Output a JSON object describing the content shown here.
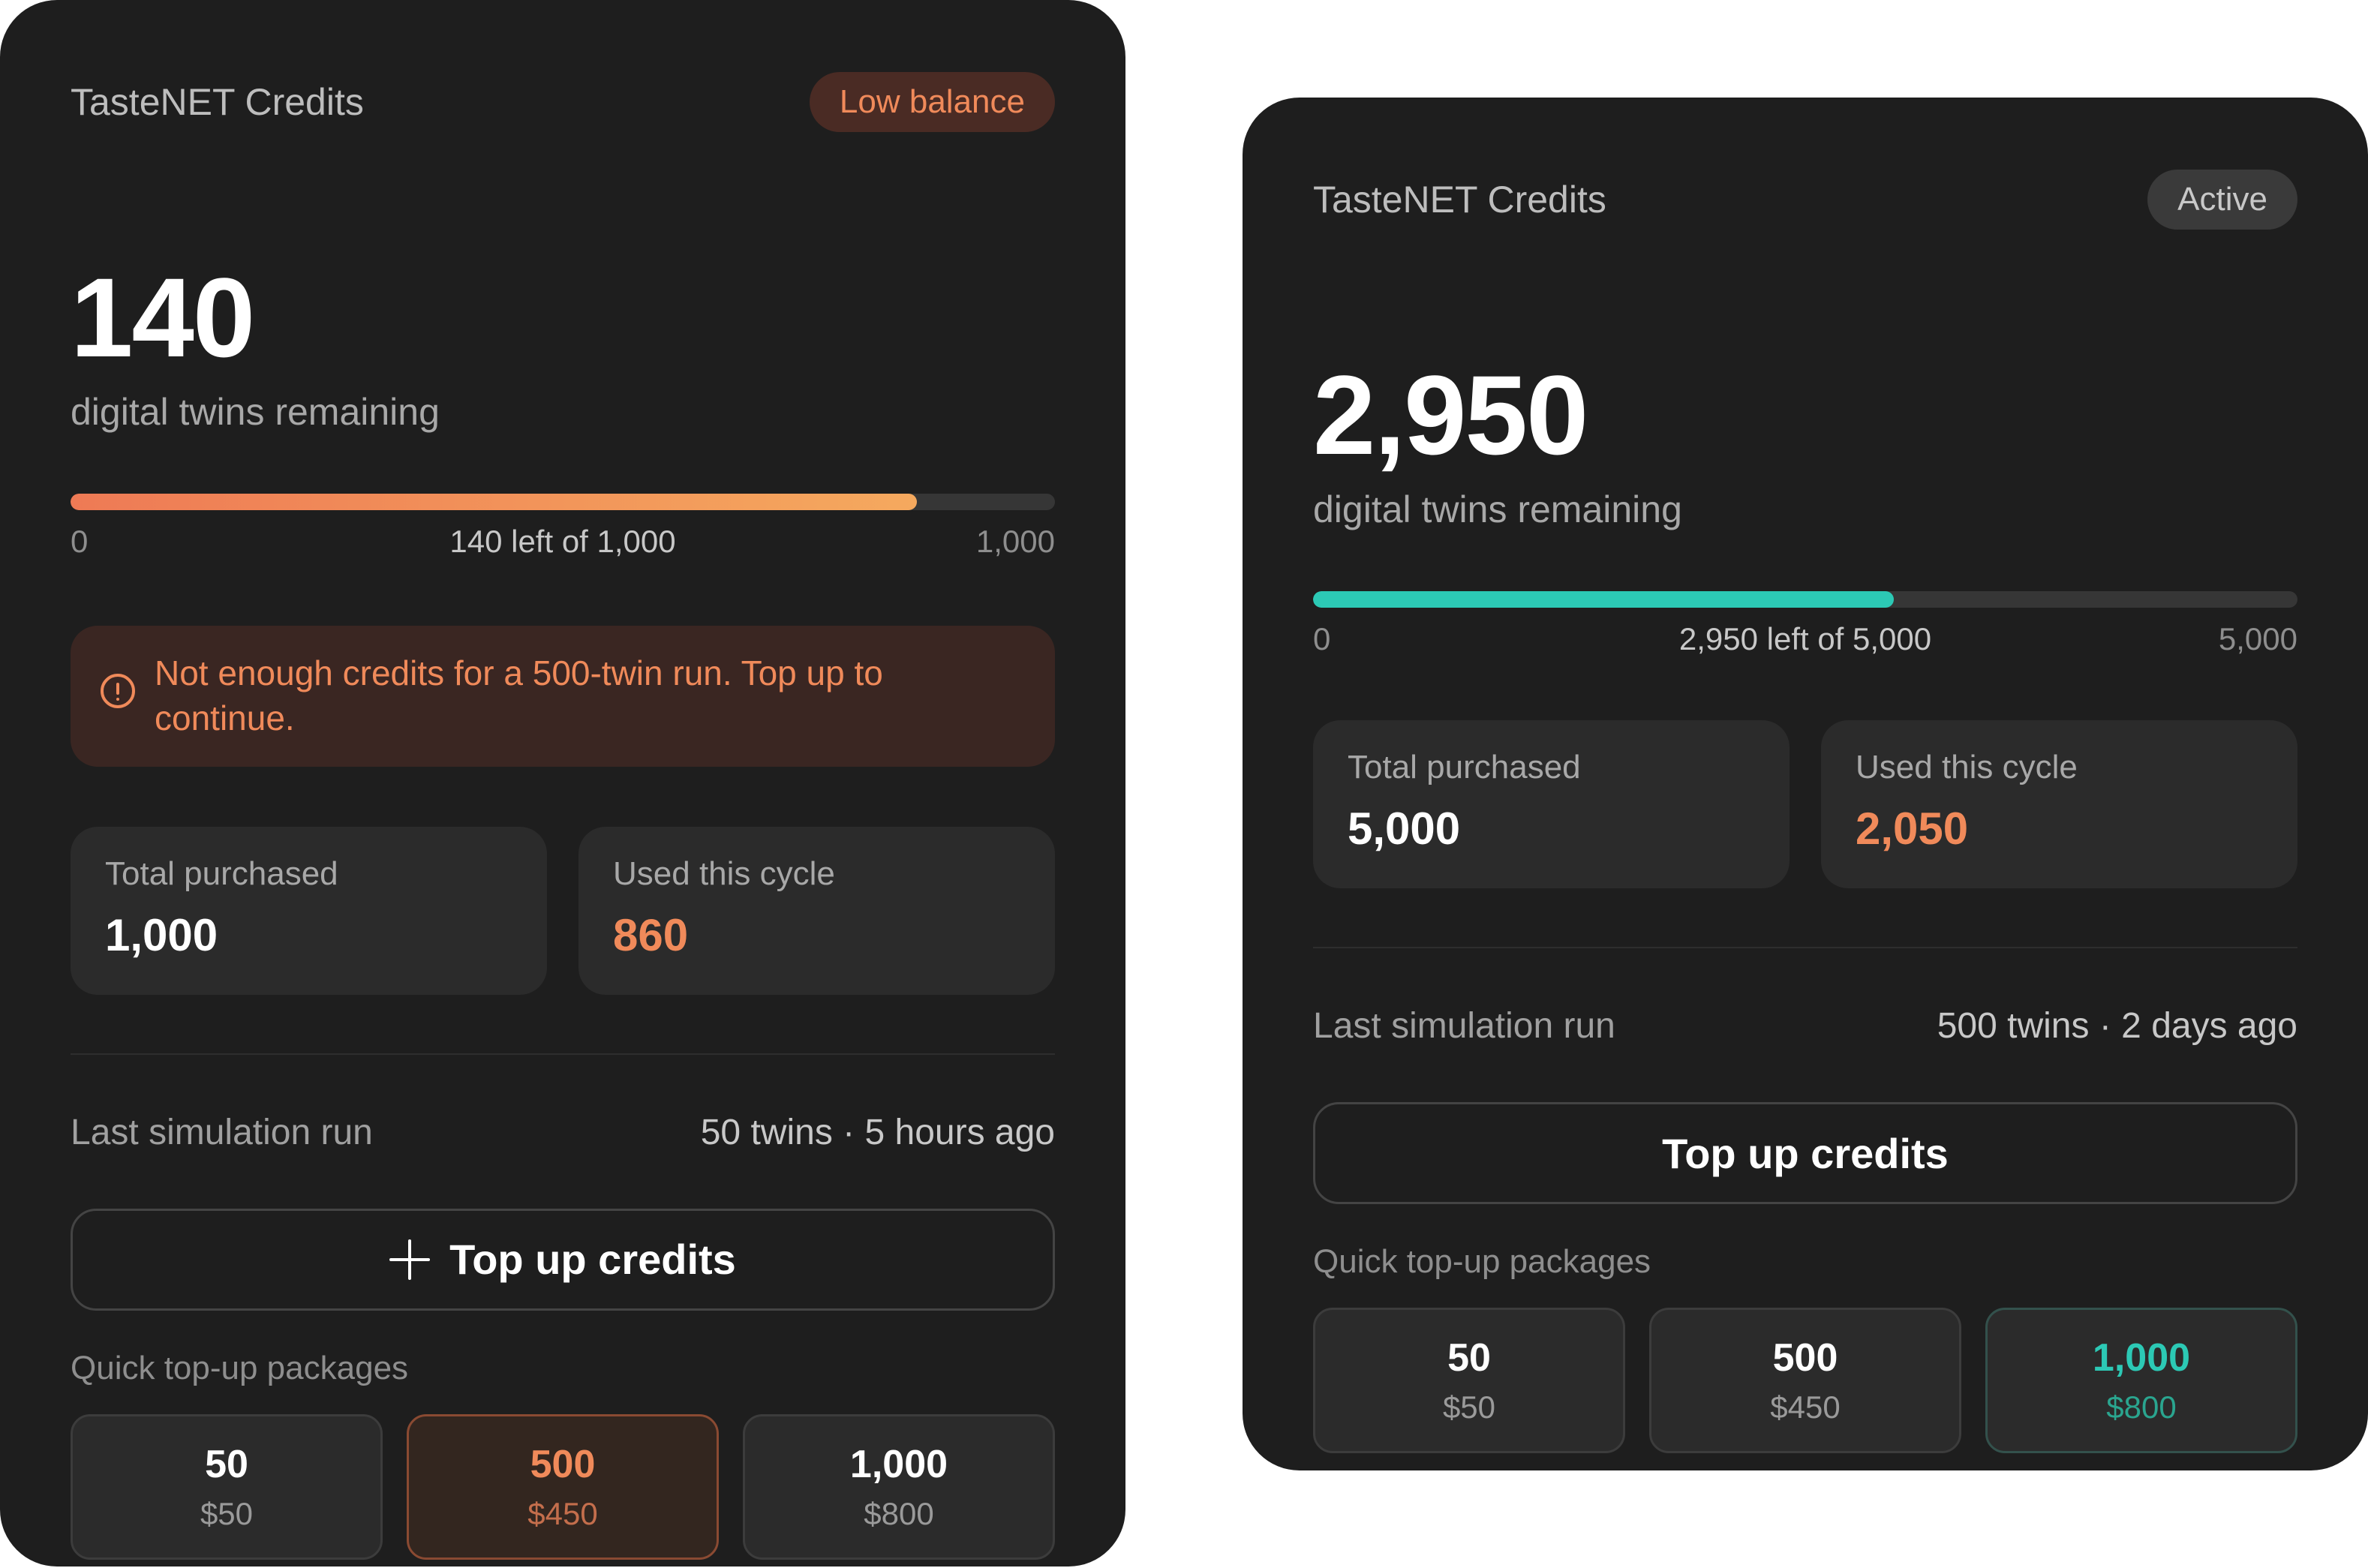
{
  "cards": [
    {
      "title": "TasteNET Credits",
      "badge": "Low balance",
      "remaining": "140",
      "remaining_label": "digital twins remaining",
      "progress": {
        "used_fraction": 0.86,
        "min": "0",
        "max": "1,000",
        "caption": "140 left of 1,000"
      },
      "alert": "Not enough credits for a 500-twin run. Top up to continue.",
      "stats": {
        "total_purchased_label": "Total purchased",
        "total_purchased": "1,000",
        "used_label": "Used this cycle",
        "used": "860"
      },
      "last_run_label": "Last simulation run",
      "last_run_value": "50 twins · 5 hours ago",
      "topup_label": "Top up credits",
      "packages_label": "Quick top-up packages",
      "packages": [
        {
          "amount": "50",
          "price": "$50"
        },
        {
          "amount": "500",
          "price": "$450",
          "selected": true
        },
        {
          "amount": "1,000",
          "price": "$800"
        }
      ],
      "accent": "#f08a5a"
    },
    {
      "title": "TasteNET Credits",
      "badge": "Active",
      "remaining": "2,950",
      "remaining_label": "digital twins remaining",
      "progress": {
        "used_fraction": 0.59,
        "min": "0",
        "max": "5,000",
        "caption": "2,950 left of 5,000"
      },
      "stats": {
        "total_purchased_label": "Total purchased",
        "total_purchased": "5,000",
        "used_label": "Used this cycle",
        "used": "2,050"
      },
      "last_run_label": "Last simulation run",
      "last_run_value": "500 twins · 2 days ago",
      "topup_label": "Top up credits",
      "packages_label": "Quick top-up packages",
      "packages": [
        {
          "amount": "50",
          "price": "$50"
        },
        {
          "amount": "500",
          "price": "$450"
        },
        {
          "amount": "1,000",
          "price": "$800",
          "selected": true
        }
      ],
      "accent": "#2cc9b5"
    }
  ]
}
